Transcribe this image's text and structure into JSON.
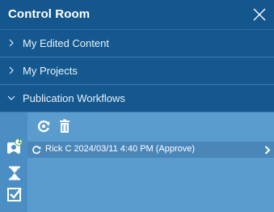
{
  "panel": {
    "title": "Control Room",
    "close_icon": "close-icon"
  },
  "sections": [
    {
      "label": "My Edited Content",
      "expanded": false
    },
    {
      "label": "My Projects",
      "expanded": false
    },
    {
      "label": "Publication Workflows",
      "expanded": true
    }
  ],
  "toolbar": {
    "refresh_icon": "refresh-icon",
    "delete_icon": "trash-icon"
  },
  "rail": {
    "items": [
      {
        "icon": "workflow-user-icon",
        "badge": "1"
      },
      {
        "icon": "hourglass-icon"
      },
      {
        "icon": "checkbox-icon"
      }
    ]
  },
  "workflow_row": {
    "icon": "sync-icon",
    "text": "Rick C 2024/03/11 4:40 PM (Approve)",
    "arrow_icon": "chevron-right-icon"
  },
  "colors": {
    "header_bg": "#14578e",
    "section_bg": "#15588f",
    "content_bg": "#5a9ccd",
    "rail_bg": "#4b8ec3",
    "row_bg": "#4a86b8",
    "badge": "#4caf50"
  }
}
